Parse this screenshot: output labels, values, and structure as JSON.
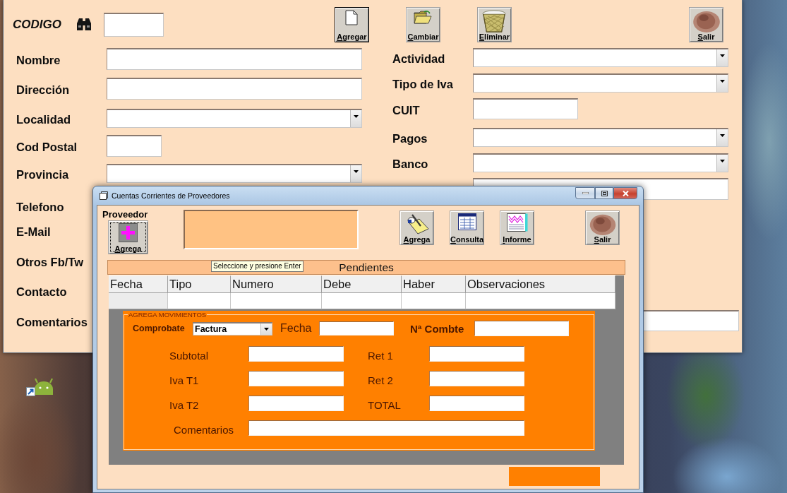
{
  "main_window": {
    "codigo_label": "CODIGO",
    "toolbar": [
      {
        "label": "Agregar",
        "kind": "new",
        "focused": true
      },
      {
        "label": "Cambiar",
        "kind": "change",
        "focused": false
      },
      {
        "label": "Eliminar",
        "kind": "delete",
        "focused": false
      },
      {
        "label": "Salir",
        "kind": "exit",
        "focused": false
      }
    ],
    "left_fields": [
      {
        "label": "Nombre",
        "kind": "text"
      },
      {
        "label": "Dirección",
        "kind": "text"
      },
      {
        "label": "Localidad",
        "kind": "combo"
      },
      {
        "label": "Cod Postal",
        "kind": "short"
      },
      {
        "label": "Provincia",
        "kind": "combo"
      }
    ],
    "right_fields": [
      {
        "label": "Actividad",
        "kind": "combo"
      },
      {
        "label": "Tipo de Iva",
        "kind": "combo"
      },
      {
        "label": "CUIT",
        "kind": "medium"
      },
      {
        "label": "Pagos",
        "kind": "combo"
      },
      {
        "label": "Banco",
        "kind": "combo"
      },
      {
        "kind": "text"
      }
    ],
    "lower_fields": [
      {
        "label": "Telefono",
        "kind": "label"
      },
      {
        "label": "E-Mail",
        "kind": "label"
      },
      {
        "label": "Otros Fb/Tw",
        "kind": "label"
      },
      {
        "label": "Contacto",
        "kind": "label"
      },
      {
        "label": "Comentarios",
        "kind": "wide"
      }
    ]
  },
  "dialog": {
    "title": "Cuentas Corrientes de Proveedores",
    "provider": {
      "label": "Proveedor",
      "button": "Agrega",
      "focused": true
    },
    "toolbar": [
      {
        "label": "Agrega",
        "kind": "write"
      },
      {
        "label": "Consulta",
        "kind": "query"
      },
      {
        "label": "Informe",
        "kind": "report"
      },
      {
        "label": "Salir",
        "kind": "exit"
      }
    ],
    "tooltip": "Seleccione y presione Enter",
    "pendientes": {
      "title": "Pendientes",
      "columns": [
        "Fecha",
        "Tipo",
        "Numero",
        "Debe",
        "Haber",
        "Observaciones"
      ]
    },
    "movimientos": {
      "title": "AGREGA MOVIMIENTOS",
      "comprobante_label": "Comprobate",
      "comprobante_value": "Factura",
      "fecha_label": "Fecha",
      "combte_label": "Nª Combte",
      "amount_rows": [
        {
          "left": "Subtotal",
          "right": "Ret 1"
        },
        {
          "left": "Iva T1",
          "right": "Ret 2"
        },
        {
          "left": "Iva T2",
          "right": "TOTAL"
        }
      ],
      "comentarios_label": "Comentarios"
    }
  }
}
